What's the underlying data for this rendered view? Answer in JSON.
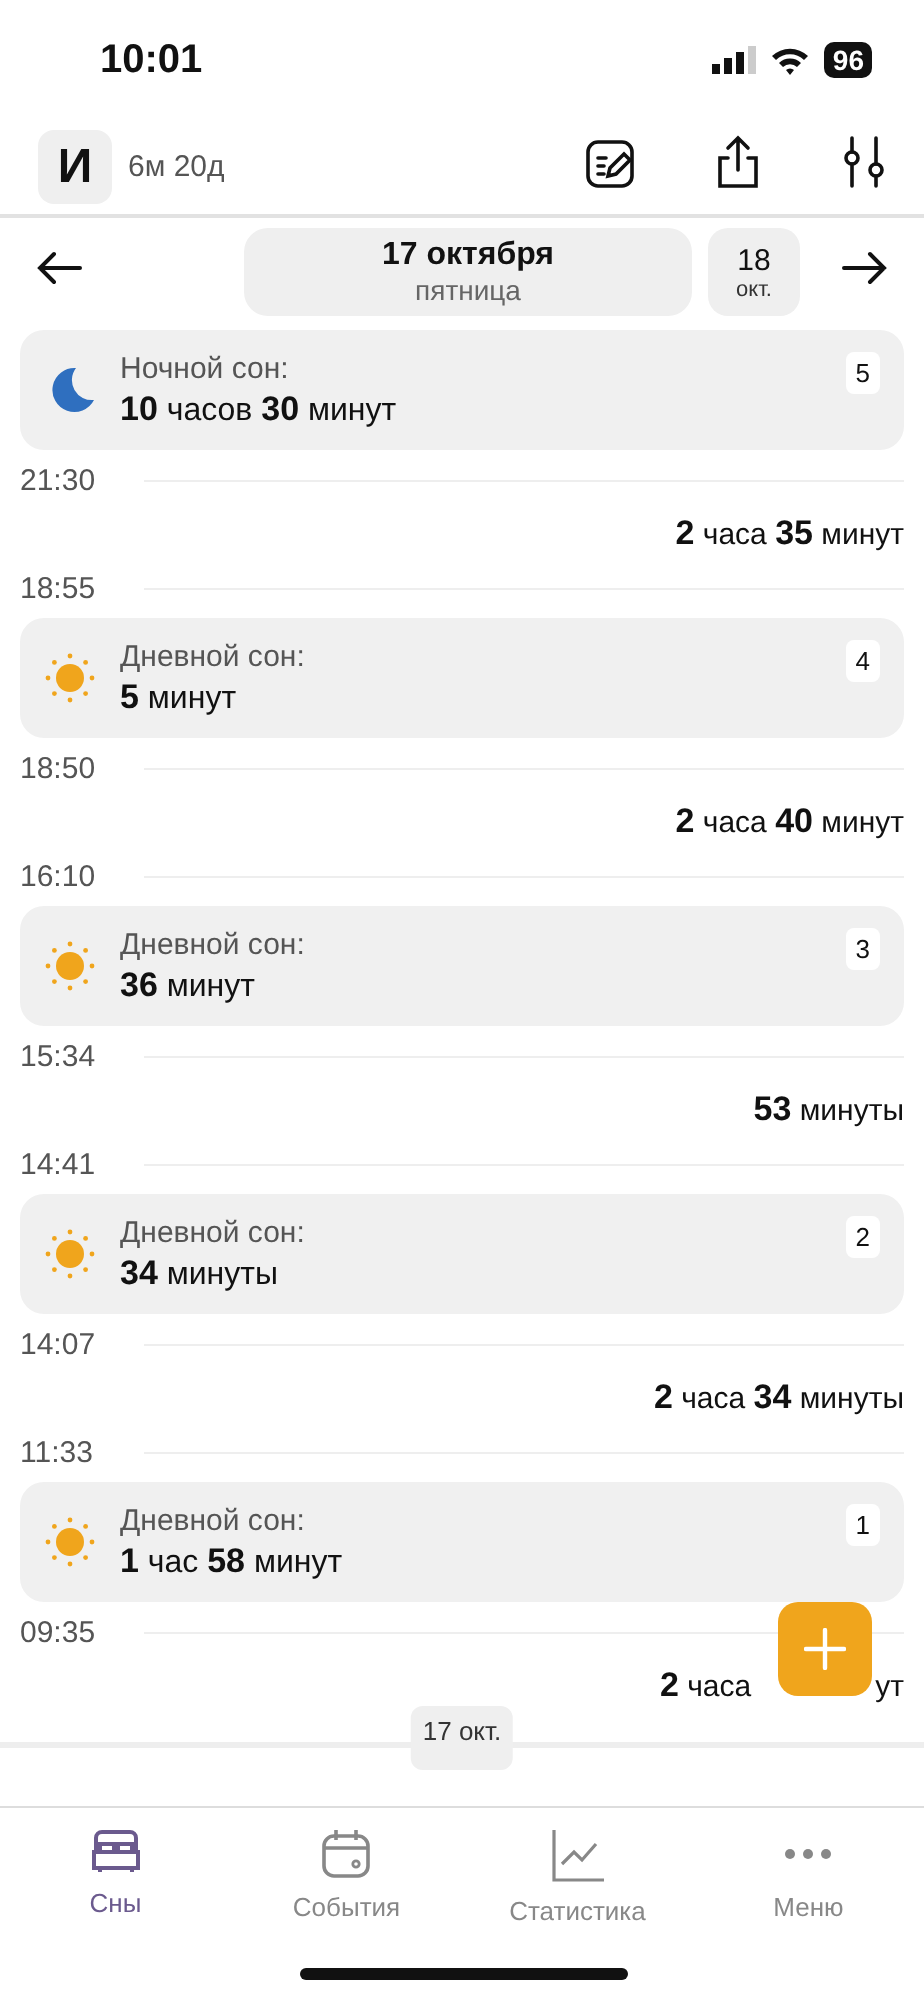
{
  "status_bar": {
    "time": "10:01",
    "battery": "96"
  },
  "header": {
    "avatar_letter": "И",
    "age": "6м 20д"
  },
  "date_nav": {
    "date": "17 октября",
    "weekday": "пятница",
    "next_day": "18",
    "next_month": "окт."
  },
  "timeline": [
    {
      "kind": "night",
      "label": "Ночной сон:",
      "duration": "**10** часов **30** минут",
      "number": "5"
    },
    {
      "kind": "time",
      "text": "21:30"
    },
    {
      "kind": "gap",
      "text": "**2** часа **35** минут"
    },
    {
      "kind": "time",
      "text": "18:55"
    },
    {
      "kind": "day",
      "label": "Дневной сон:",
      "duration": "**5** минут",
      "number": "4"
    },
    {
      "kind": "time",
      "text": "18:50"
    },
    {
      "kind": "gap",
      "text": "**2** часа **40** минут"
    },
    {
      "kind": "time",
      "text": "16:10"
    },
    {
      "kind": "day",
      "label": "Дневной сон:",
      "duration": "**36** минут",
      "number": "3"
    },
    {
      "kind": "time",
      "text": "15:34"
    },
    {
      "kind": "gap",
      "text": "**53** минуты"
    },
    {
      "kind": "time",
      "text": "14:41"
    },
    {
      "kind": "day",
      "label": "Дневной сон:",
      "duration": "**34** минуты",
      "number": "2"
    },
    {
      "kind": "time",
      "text": "14:07"
    },
    {
      "kind": "gap",
      "text": "**2** часа **34** минуты"
    },
    {
      "kind": "time",
      "text": "11:33"
    },
    {
      "kind": "day",
      "label": "Дневной сон:",
      "duration": "**1** час **58** минут",
      "number": "1"
    },
    {
      "kind": "time",
      "text": "09:35"
    },
    {
      "kind": "gap",
      "text": "**2** часа",
      "tail": "ут"
    }
  ],
  "date_chip": "17 окт.",
  "tabs": [
    {
      "label": "Сны",
      "kind": "bed",
      "selected": true
    },
    {
      "label": "События",
      "kind": "calendar",
      "selected": false
    },
    {
      "label": "Статистика",
      "kind": "chart",
      "selected": false
    },
    {
      "label": "Меню",
      "kind": "dots",
      "selected": false
    }
  ]
}
